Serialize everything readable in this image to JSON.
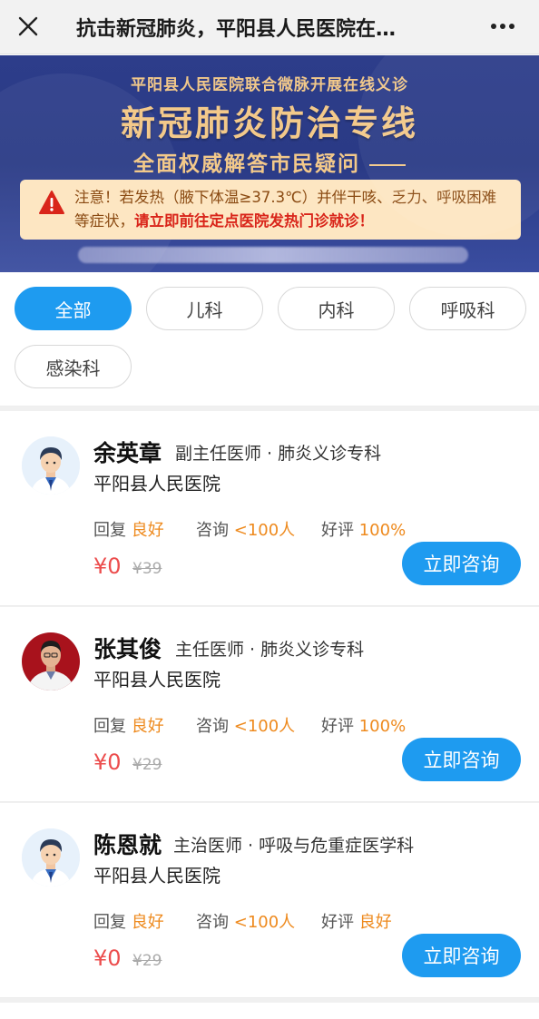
{
  "header": {
    "title": "抗击新冠肺炎，平阳县人民医院在…",
    "close_icon": "close-icon",
    "more_icon": "more-dots-icon"
  },
  "banner": {
    "subtitle": "平阳县人民医院联合微脉开展在线义诊",
    "title": "新冠肺炎防治专线",
    "tagline": "全面权威解答市民疑问",
    "notice_lead": "注意！若发热（腋下体温≥37.3℃）并伴干咳、乏力、呼吸困难等症状，",
    "notice_emphasis": "请立即前往定点医院发热门诊就诊！",
    "warning_icon": "warning-icon",
    "colors": {
      "background": "#2d3d8a",
      "gold": "#f3c98a",
      "notice_bg": "#fde6c2",
      "alert_red": "#d9251a"
    }
  },
  "filters": {
    "chips": [
      {
        "label": "全部",
        "active": true
      },
      {
        "label": "儿科",
        "active": false
      },
      {
        "label": "内科",
        "active": false
      },
      {
        "label": "呼吸科",
        "active": false
      },
      {
        "label": "感染科",
        "active": false
      }
    ],
    "accent": "#1e9bf0"
  },
  "doctors": [
    {
      "name": "余英章",
      "rank": "副主任医师 · 肺炎义诊专科",
      "hospital": "平阳县人民医院",
      "reply_label": "回复",
      "reply_value": "良好",
      "consult_label": "咨询",
      "consult_value": "<100人",
      "rating_label": "好评",
      "rating_value": "100%",
      "price": "¥0",
      "old_price": "¥39",
      "button": "立即咨询",
      "avatar": "cartoon-doctor-avatar"
    },
    {
      "name": "张其俊",
      "rank": "主任医师 · 肺炎义诊专科",
      "hospital": "平阳县人民医院",
      "reply_label": "回复",
      "reply_value": "良好",
      "consult_label": "咨询",
      "consult_value": "<100人",
      "rating_label": "好评",
      "rating_value": "100%",
      "price": "¥0",
      "old_price": "¥29",
      "button": "立即咨询",
      "avatar": "photo-avatar"
    },
    {
      "name": "陈恩就",
      "rank": "主治医师 · 呼吸与危重症医学科",
      "hospital": "平阳县人民医院",
      "reply_label": "回复",
      "reply_value": "良好",
      "consult_label": "咨询",
      "consult_value": "<100人",
      "rating_label": "好评",
      "rating_value": "良好",
      "price": "¥0",
      "old_price": "¥29",
      "button": "立即咨询",
      "avatar": "cartoon-doctor-avatar"
    }
  ]
}
